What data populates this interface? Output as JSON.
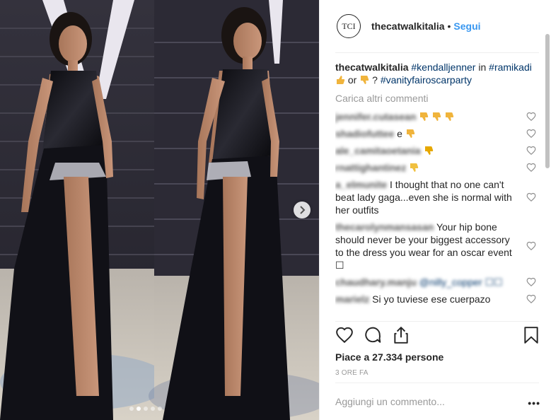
{
  "post": {
    "account": "thecatwalkitalia",
    "avatar_text": "TCI",
    "separator": "•",
    "follow_label": "Segui",
    "caption": {
      "user": "thecatwalkitalia",
      "tag1": "#kendalljenner",
      "word_in": "in",
      "tag2": "#ramikadi",
      "word_or": "or",
      "question": "?",
      "tag3": "#vanityfairoscarparty"
    },
    "load_more": "Carica altri commenti",
    "comments": [
      {
        "user": "jennifer.cutasean",
        "text": ""
      },
      {
        "user": "shadiofuttee",
        "text": "e"
      },
      {
        "user": "ale_camitaoetania",
        "text": ""
      },
      {
        "user": "rnattighantinez",
        "text": ""
      },
      {
        "user": "a_elmunite",
        "text": "I thought that no one can't beat lady gaga...even she is normal with her outfits"
      },
      {
        "user": "thecarolynmansasan",
        "text": "Your hip bone should never be your biggest accessory to the dress you wear for an oscar event ☐"
      },
      {
        "user": "chaudhary.manju",
        "text": "@nilly_copper ☐☐"
      },
      {
        "user": "marielz",
        "text": "Si yo tuviese ese cuerpazo"
      }
    ],
    "likes": "Piace a 27.334 persone",
    "time": "3 ORE FA",
    "comment_placeholder": "Aggiungi un commento...",
    "more_label": "•••",
    "carousel": {
      "slides": 5,
      "active": 2
    }
  },
  "icons": [
    "heart-icon",
    "comment-icon",
    "share-icon",
    "bookmark-icon",
    "chevron-right-icon",
    "thumbs-down-icon",
    "thumbs-up-icon"
  ],
  "colors": {
    "link": "#3897f0",
    "hashtag": "#003569",
    "muted": "#999999",
    "text": "#262626",
    "emoji": "#f0b43c"
  }
}
